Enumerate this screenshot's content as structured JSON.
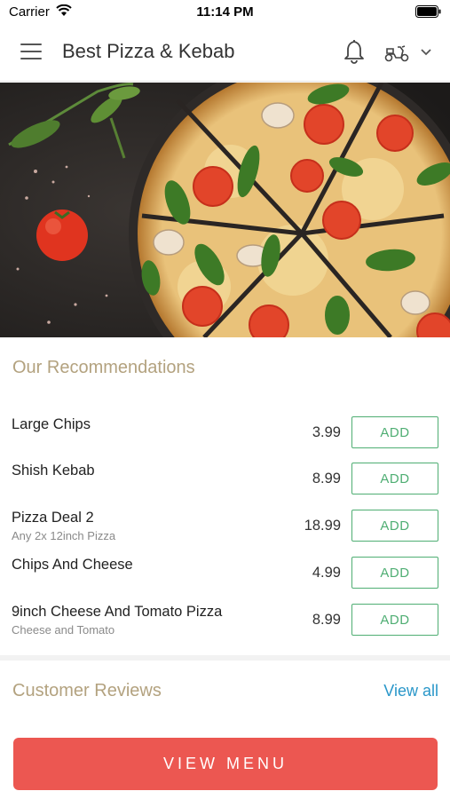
{
  "status_bar": {
    "carrier": "Carrier",
    "time": "11:14 PM"
  },
  "header": {
    "title": "Best Pizza & Kebab"
  },
  "recommendations": {
    "title": "Our Recommendations",
    "add_label": "ADD",
    "items": [
      {
        "name": "Large Chips",
        "description": "",
        "price": "3.99"
      },
      {
        "name": "Shish Kebab",
        "description": "",
        "price": "8.99"
      },
      {
        "name": "Pizza Deal 2",
        "description": "Any 2x 12inch Pizza",
        "price": "18.99"
      },
      {
        "name": "Chips And Cheese",
        "description": "",
        "price": "4.99"
      },
      {
        "name": "9inch Cheese And Tomato Pizza",
        "description": "Cheese and Tomato",
        "price": "8.99"
      }
    ]
  },
  "reviews": {
    "title": "Customer Reviews",
    "view_all": "View all"
  },
  "footer": {
    "view_menu": "VIEW MENU"
  },
  "colors": {
    "accent_green": "#4fae73",
    "cta_red": "#ec5751",
    "section_title": "#b3a27f",
    "link_blue": "#2a97c9"
  }
}
